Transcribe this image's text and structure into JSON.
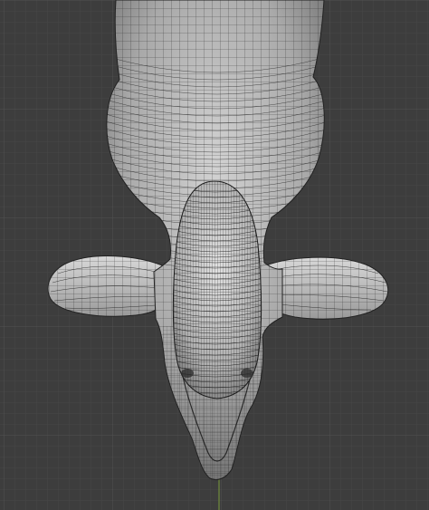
{
  "viewport": {
    "mode": "wireframe-overlay",
    "background_color": "#3d3d3d",
    "grid_minor_color": "#474747",
    "grid_major_color": "#515151",
    "mesh_fill_color": "#b4b4b4",
    "wire_color": "#1c1c1c",
    "axis_color": "#7a9a3a",
    "object": "creature-head-mesh"
  }
}
